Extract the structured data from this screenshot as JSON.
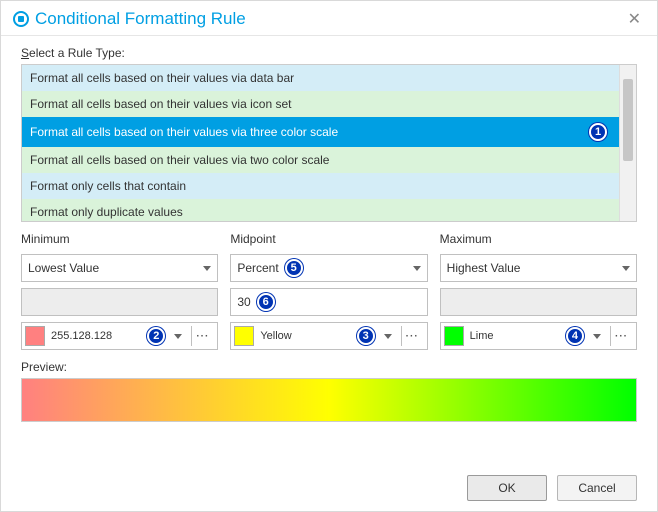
{
  "header": {
    "title": "Conditional Formatting Rule"
  },
  "ruleTypeLabel": "elect a Rule Type:",
  "ruleTypeAccess": "S",
  "rules": [
    "Format all cells based on their values via data bar",
    "Format all cells based on their values via icon set",
    "Format all cells based on their values via three color scale",
    "Format all cells based on their values via two color scale",
    "Format only cells that contain",
    "Format only duplicate values"
  ],
  "selectedRuleIndex": 2,
  "callouts": {
    "ruleSelected": "1",
    "minColor": "2",
    "midColor": "3",
    "maxColor": "4",
    "midType": "5",
    "midValue": "6"
  },
  "columns": {
    "min": {
      "label": "Minimum",
      "type": "Lowest Value",
      "value": "",
      "color": {
        "hex": "#ff8080",
        "name": "255.128.128"
      }
    },
    "mid": {
      "label": "Midpoint",
      "type": "Percent",
      "value": "30",
      "color": {
        "hex": "#ffff00",
        "name": "Yellow"
      }
    },
    "max": {
      "label": "Maximum",
      "type": "Highest Value",
      "value": "",
      "color": {
        "hex": "#00ff00",
        "name": "Lime"
      }
    }
  },
  "previewLabel": "Preview:",
  "buttons": {
    "ok": "OK",
    "cancel": "Cancel"
  },
  "moreGlyph": "···"
}
